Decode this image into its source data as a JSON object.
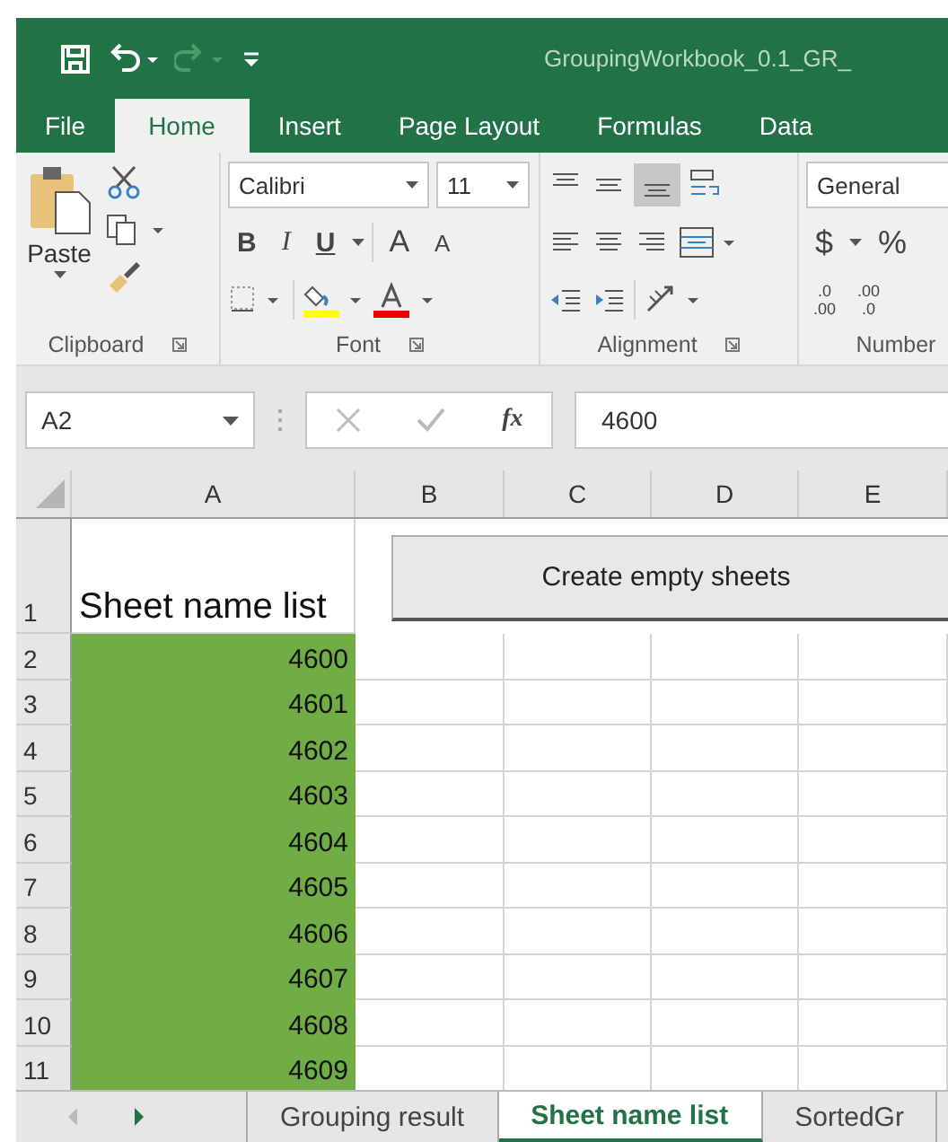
{
  "window": {
    "title": "GroupingWorkbook_0.1_GR_"
  },
  "tabs": [
    {
      "label": "File",
      "selected": false
    },
    {
      "label": "Home",
      "selected": true
    },
    {
      "label": "Insert",
      "selected": false
    },
    {
      "label": "Page Layout",
      "selected": false
    },
    {
      "label": "Formulas",
      "selected": false
    },
    {
      "label": "Data",
      "selected": false
    }
  ],
  "ribbon": {
    "paste": "Paste",
    "font_name": "Calibri",
    "font_size": "11",
    "bold": "B",
    "italic": "I",
    "underline": "U",
    "grow": "A",
    "shrink": "A",
    "number_format": "General",
    "currency": "$",
    "percent": "%",
    "decimals": [
      {
        "top": ".0",
        "bottom": ".00"
      },
      {
        "top": ".00",
        "bottom": ".0"
      }
    ],
    "groups": [
      "Clipboard",
      "Font",
      "Alignment",
      "Number"
    ]
  },
  "formula_bar": {
    "name_box": "A2",
    "fx": "fx",
    "value": "4600"
  },
  "columns": [
    "A",
    "B",
    "C",
    "D",
    "E"
  ],
  "rows": [
    {
      "number": "1",
      "a": "Sheet name list",
      "filled": false
    },
    {
      "number": "2",
      "a": "4600",
      "filled": true
    },
    {
      "number": "3",
      "a": "4601",
      "filled": true
    },
    {
      "number": "4",
      "a": "4602",
      "filled": true
    },
    {
      "number": "5",
      "a": "4603",
      "filled": true
    },
    {
      "number": "6",
      "a": "4604",
      "filled": true
    },
    {
      "number": "7",
      "a": "4605",
      "filled": true
    },
    {
      "number": "8",
      "a": "4606",
      "filled": true
    },
    {
      "number": "9",
      "a": "4607",
      "filled": true
    },
    {
      "number": "10",
      "a": "4608",
      "filled": true
    },
    {
      "number": "11",
      "a": "4609",
      "filled": true
    }
  ],
  "sheet_button": "Create empty sheets",
  "sheet_tabs": [
    {
      "label": "Grouping result",
      "selected": false
    },
    {
      "label": "Sheet name list",
      "selected": true
    },
    {
      "label": "SortedGr",
      "selected": false
    }
  ]
}
